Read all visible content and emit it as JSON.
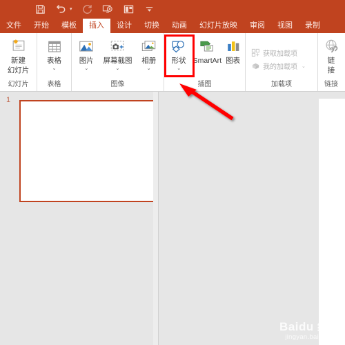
{
  "app": {
    "accent_color": "#c0431f",
    "highlight_color": "#ff0000",
    "canvas_color": "#ffffff",
    "workspace_color": "#e6e6e6"
  },
  "quick_access": [
    {
      "name": "save-icon",
      "label": "保存"
    },
    {
      "name": "undo-icon",
      "label": "撤消"
    },
    {
      "name": "redo-icon",
      "label": "恢复"
    },
    {
      "name": "start-slideshow-icon",
      "label": "从头开始"
    },
    {
      "name": "layout-icon",
      "label": "幻灯片版式"
    },
    {
      "name": "customize-qat-icon",
      "label": "自定义快速访问工具栏"
    }
  ],
  "tabs": [
    {
      "label": "文件",
      "active": false
    },
    {
      "label": "开始",
      "active": false
    },
    {
      "label": "模板",
      "active": false
    },
    {
      "label": "插入",
      "active": true
    },
    {
      "label": "设计",
      "active": false
    },
    {
      "label": "切换",
      "active": false
    },
    {
      "label": "动画",
      "active": false
    },
    {
      "label": "幻灯片放映",
      "active": false
    },
    {
      "label": "审阅",
      "active": false
    },
    {
      "label": "视图",
      "active": false
    },
    {
      "label": "录制",
      "active": false
    }
  ],
  "ribbon": {
    "groups": [
      {
        "label": "幻灯片",
        "buttons": [
          {
            "label_line1": "新建",
            "label_line2": "幻灯片",
            "icon": "new-slide-icon",
            "caret": true,
            "inline_caret": true
          }
        ]
      },
      {
        "label": "表格",
        "buttons": [
          {
            "label_line1": "表格",
            "label_line2": "",
            "icon": "table-icon",
            "caret": true
          }
        ]
      },
      {
        "label": "图像",
        "buttons": [
          {
            "label_line1": "图片",
            "label_line2": "",
            "icon": "picture-icon",
            "caret": true
          },
          {
            "label_line1": "屏幕截图",
            "label_line2": "",
            "icon": "screenshot-icon",
            "caret": true
          },
          {
            "label_line1": "相册",
            "label_line2": "",
            "icon": "photo-album-icon",
            "caret": true
          }
        ]
      },
      {
        "label": "插图",
        "buttons": [
          {
            "label_line1": "形状",
            "label_line2": "",
            "icon": "shapes-icon",
            "caret": true,
            "highlighted": true
          },
          {
            "label_line1": "SmartArt",
            "label_line2": "",
            "icon": "smartart-icon",
            "caret": false
          },
          {
            "label_line1": "图表",
            "label_line2": "",
            "icon": "chart-icon",
            "caret": false
          }
        ]
      },
      {
        "label": "加载项",
        "small_items": [
          {
            "label": "获取加载项",
            "icon": "get-addins-icon",
            "caret": false,
            "disabled": true
          },
          {
            "label": "我的加载项",
            "icon": "my-addins-icon",
            "caret": true,
            "disabled": true
          }
        ]
      },
      {
        "label": "链接",
        "buttons": [
          {
            "label_line1": "链",
            "label_line2": "接",
            "icon": "link-icon",
            "caret": false
          }
        ]
      }
    ]
  },
  "thumbnail_pane": {
    "slides": [
      {
        "number": "1",
        "selected": true
      }
    ]
  },
  "annotation": {
    "arrow_name": "red-pointer-arrow",
    "points_at": "形状"
  },
  "watermark": {
    "line1": "Baidu 经验",
    "line2": "jingyan.baidu.com"
  }
}
